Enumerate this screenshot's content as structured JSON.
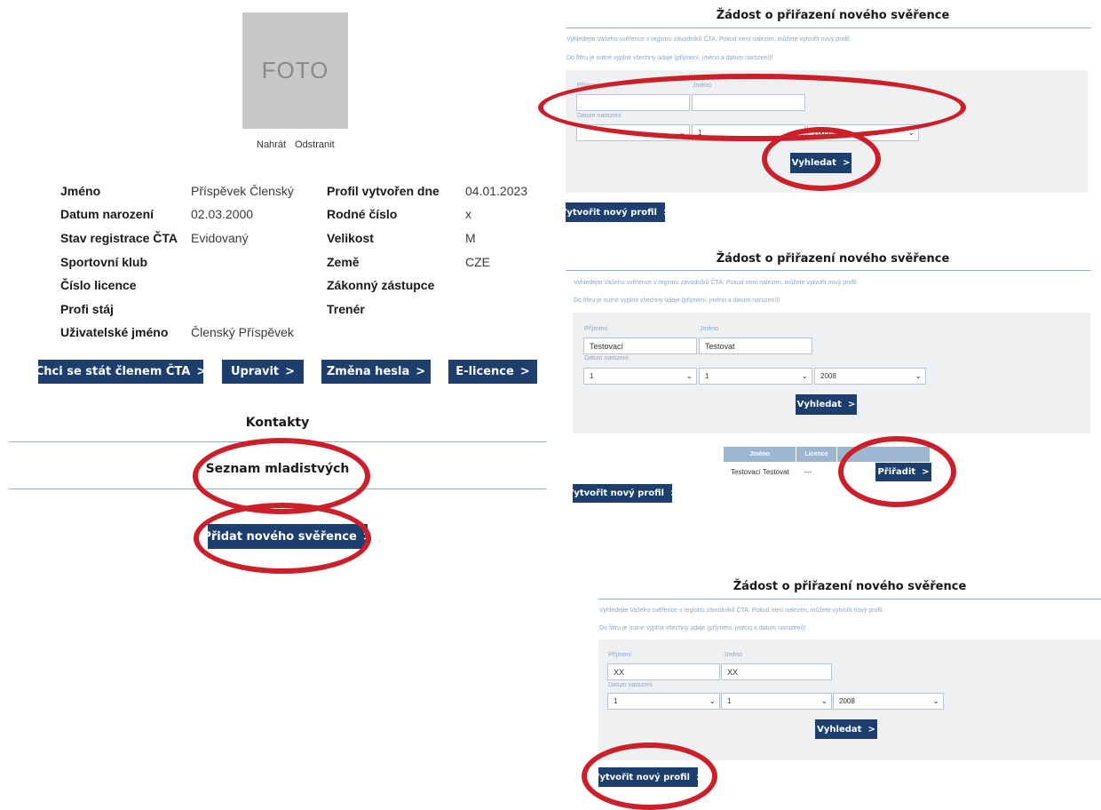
{
  "profile": {
    "photo_placeholder": "FOTO",
    "upload_link": "Nahrát",
    "remove_link": "Odstranit",
    "fields_left": [
      {
        "label": "Jméno",
        "value": "Příspěvek Členský"
      },
      {
        "label": "Datum narození",
        "value": "02.03.2000"
      },
      {
        "label": "Stav registrace ČTA",
        "value": "Evidovaný"
      },
      {
        "label": "Sportovní klub",
        "value": ""
      },
      {
        "label": "Číslo licence",
        "value": ""
      },
      {
        "label": "Profi stáj",
        "value": ""
      },
      {
        "label": "Uživatelské jméno",
        "value": "Členský Příspěvek"
      }
    ],
    "fields_right": [
      {
        "label": "Profil vytvořen dne",
        "value": "04.01.2023"
      },
      {
        "label": "Rodné číslo",
        "value": "x"
      },
      {
        "label": "Velikost",
        "value": "M"
      },
      {
        "label": "Země",
        "value": "CZE"
      },
      {
        "label": "Zákonný zástupce",
        "value": ""
      },
      {
        "label": "Trenér",
        "value": ""
      }
    ],
    "buttons": {
      "member": "Chci se stát členem ČTA",
      "edit": "Upravit",
      "password": "Změna hesla",
      "elicence": "E-licence"
    },
    "contacts_heading": "Kontakty",
    "minors_heading": "Seznam mladistvých",
    "add_ward_button": "Přidat nového svěřence"
  },
  "chevron": ">",
  "panels": [
    {
      "title": "Žádost o přiřazení nového svěřence",
      "hint1": "Vyhledejte Vašeho svěřence v registru závodníků ČTA. Pokud není nalezen, můžete vytvořit nový profil.",
      "hint2": "Do filtru je nutné vyplnit všechny údaje (příjmení, jméno a datum narození)!",
      "surname_label": "Příjmení",
      "name_label": "Jméno",
      "dob_label": "Datum narození",
      "surname_value": "",
      "name_value": "",
      "day": "",
      "month": "1",
      "year": "2005",
      "search_button": "Vyhledat",
      "create_button": "Vytvořit nový profil"
    },
    {
      "title": "Žádost o přiřazení nového svěřence",
      "hint1": "Vyhledejte Vašeho svěřence v registru závodníků ČTA. Pokud není nalezen, můžete vytvořit nový profil.",
      "hint2": "Do filtru je nutné vyplnit všechny údaje (příjmení, jméno a datum narození)!",
      "surname_label": "Příjmení",
      "name_label": "Jméno",
      "dob_label": "Datum narození",
      "surname_value": "Testovací",
      "name_value": "Testovat",
      "day": "1",
      "month": "1",
      "year": "2008",
      "search_button": "Vyhledat",
      "results_headers": [
        "Jméno",
        "Licence",
        ""
      ],
      "result_name": "Testovací Testovat",
      "result_licence": "---",
      "assign_button": "Přiřadit",
      "create_button": "Vytvořit nový profil"
    },
    {
      "title": "Žádost o přiřazení nového svěřence",
      "hint1": "Vyhledejte Vašeho svěřence v registru závodníků ČTA. Pokud není nalezen, můžete vytvořit nový profil.",
      "hint2": "Do filtru je nutné vyplnit všechny údaje (příjmení, jméno a datum narození)!",
      "surname_label": "Příjmení",
      "name_label": "Jméno",
      "dob_label": "Datum narození",
      "surname_value": "XX",
      "name_value": "XX",
      "day": "1",
      "month": "1",
      "year": "2008",
      "search_button": "Vyhledat",
      "create_button": "Vytvořit nový profil"
    }
  ],
  "colors": {
    "primary": "#1c3f6e",
    "annotation": "#cc1f2a",
    "filter_bg": "#eef0f2",
    "hint": "#8aa8c5"
  }
}
